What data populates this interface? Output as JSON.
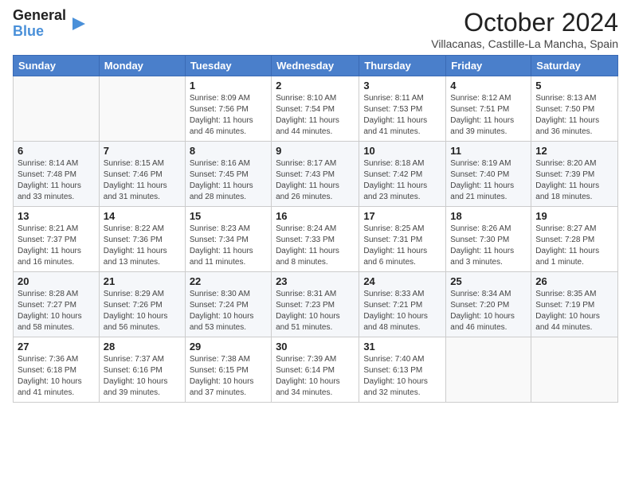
{
  "header": {
    "logo_line1": "General",
    "logo_line2": "Blue",
    "month": "October 2024",
    "location": "Villacanas, Castille-La Mancha, Spain"
  },
  "weekdays": [
    "Sunday",
    "Monday",
    "Tuesday",
    "Wednesday",
    "Thursday",
    "Friday",
    "Saturday"
  ],
  "weeks": [
    [
      {
        "day": "",
        "info": ""
      },
      {
        "day": "",
        "info": ""
      },
      {
        "day": "1",
        "info": "Sunrise: 8:09 AM\nSunset: 7:56 PM\nDaylight: 11 hours and 46 minutes."
      },
      {
        "day": "2",
        "info": "Sunrise: 8:10 AM\nSunset: 7:54 PM\nDaylight: 11 hours and 44 minutes."
      },
      {
        "day": "3",
        "info": "Sunrise: 8:11 AM\nSunset: 7:53 PM\nDaylight: 11 hours and 41 minutes."
      },
      {
        "day": "4",
        "info": "Sunrise: 8:12 AM\nSunset: 7:51 PM\nDaylight: 11 hours and 39 minutes."
      },
      {
        "day": "5",
        "info": "Sunrise: 8:13 AM\nSunset: 7:50 PM\nDaylight: 11 hours and 36 minutes."
      }
    ],
    [
      {
        "day": "6",
        "info": "Sunrise: 8:14 AM\nSunset: 7:48 PM\nDaylight: 11 hours and 33 minutes."
      },
      {
        "day": "7",
        "info": "Sunrise: 8:15 AM\nSunset: 7:46 PM\nDaylight: 11 hours and 31 minutes."
      },
      {
        "day": "8",
        "info": "Sunrise: 8:16 AM\nSunset: 7:45 PM\nDaylight: 11 hours and 28 minutes."
      },
      {
        "day": "9",
        "info": "Sunrise: 8:17 AM\nSunset: 7:43 PM\nDaylight: 11 hours and 26 minutes."
      },
      {
        "day": "10",
        "info": "Sunrise: 8:18 AM\nSunset: 7:42 PM\nDaylight: 11 hours and 23 minutes."
      },
      {
        "day": "11",
        "info": "Sunrise: 8:19 AM\nSunset: 7:40 PM\nDaylight: 11 hours and 21 minutes."
      },
      {
        "day": "12",
        "info": "Sunrise: 8:20 AM\nSunset: 7:39 PM\nDaylight: 11 hours and 18 minutes."
      }
    ],
    [
      {
        "day": "13",
        "info": "Sunrise: 8:21 AM\nSunset: 7:37 PM\nDaylight: 11 hours and 16 minutes."
      },
      {
        "day": "14",
        "info": "Sunrise: 8:22 AM\nSunset: 7:36 PM\nDaylight: 11 hours and 13 minutes."
      },
      {
        "day": "15",
        "info": "Sunrise: 8:23 AM\nSunset: 7:34 PM\nDaylight: 11 hours and 11 minutes."
      },
      {
        "day": "16",
        "info": "Sunrise: 8:24 AM\nSunset: 7:33 PM\nDaylight: 11 hours and 8 minutes."
      },
      {
        "day": "17",
        "info": "Sunrise: 8:25 AM\nSunset: 7:31 PM\nDaylight: 11 hours and 6 minutes."
      },
      {
        "day": "18",
        "info": "Sunrise: 8:26 AM\nSunset: 7:30 PM\nDaylight: 11 hours and 3 minutes."
      },
      {
        "day": "19",
        "info": "Sunrise: 8:27 AM\nSunset: 7:28 PM\nDaylight: 11 hours and 1 minute."
      }
    ],
    [
      {
        "day": "20",
        "info": "Sunrise: 8:28 AM\nSunset: 7:27 PM\nDaylight: 10 hours and 58 minutes."
      },
      {
        "day": "21",
        "info": "Sunrise: 8:29 AM\nSunset: 7:26 PM\nDaylight: 10 hours and 56 minutes."
      },
      {
        "day": "22",
        "info": "Sunrise: 8:30 AM\nSunset: 7:24 PM\nDaylight: 10 hours and 53 minutes."
      },
      {
        "day": "23",
        "info": "Sunrise: 8:31 AM\nSunset: 7:23 PM\nDaylight: 10 hours and 51 minutes."
      },
      {
        "day": "24",
        "info": "Sunrise: 8:33 AM\nSunset: 7:21 PM\nDaylight: 10 hours and 48 minutes."
      },
      {
        "day": "25",
        "info": "Sunrise: 8:34 AM\nSunset: 7:20 PM\nDaylight: 10 hours and 46 minutes."
      },
      {
        "day": "26",
        "info": "Sunrise: 8:35 AM\nSunset: 7:19 PM\nDaylight: 10 hours and 44 minutes."
      }
    ],
    [
      {
        "day": "27",
        "info": "Sunrise: 7:36 AM\nSunset: 6:18 PM\nDaylight: 10 hours and 41 minutes."
      },
      {
        "day": "28",
        "info": "Sunrise: 7:37 AM\nSunset: 6:16 PM\nDaylight: 10 hours and 39 minutes."
      },
      {
        "day": "29",
        "info": "Sunrise: 7:38 AM\nSunset: 6:15 PM\nDaylight: 10 hours and 37 minutes."
      },
      {
        "day": "30",
        "info": "Sunrise: 7:39 AM\nSunset: 6:14 PM\nDaylight: 10 hours and 34 minutes."
      },
      {
        "day": "31",
        "info": "Sunrise: 7:40 AM\nSunset: 6:13 PM\nDaylight: 10 hours and 32 minutes."
      },
      {
        "day": "",
        "info": ""
      },
      {
        "day": "",
        "info": ""
      }
    ]
  ]
}
